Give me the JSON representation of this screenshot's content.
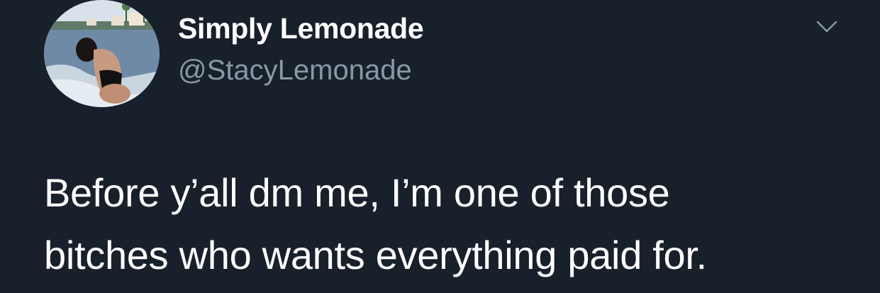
{
  "tweet": {
    "display_name": "Simply Lemonade",
    "handle": "@StacyLemonade",
    "text_lines": [
      "Before y’all dm me, I’m one of those",
      "bitches who wants everything paid for."
    ]
  },
  "icons": {
    "menu": "chevron-down-icon",
    "avatar": "profile-photo"
  },
  "colors": {
    "background": "#18202b",
    "text": "#ffffff",
    "secondary_text": "#8899a6"
  }
}
